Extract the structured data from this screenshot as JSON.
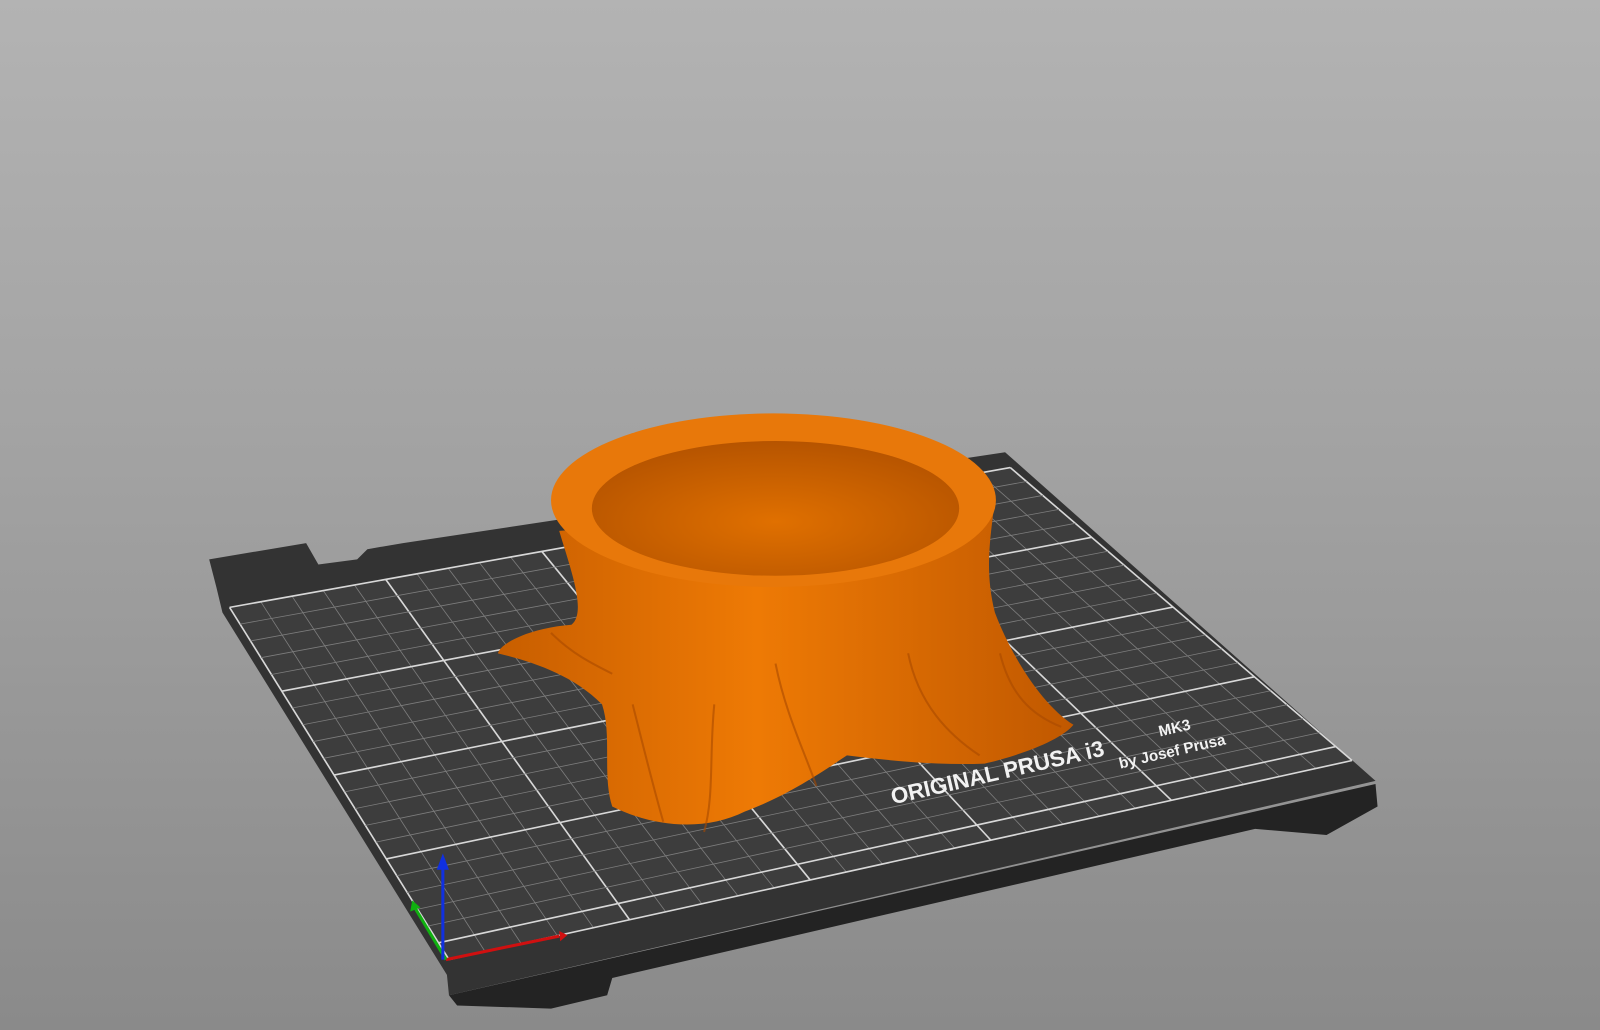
{
  "viewport": {
    "bed_logo_line1": "ORIGINAL PRUSA i3",
    "bed_logo_model": "MK3",
    "bed_logo_line2": "by Josef Prusa",
    "grid_divisions": [
      25,
      21
    ]
  },
  "colors": {
    "background_top": "#b3b3b3",
    "background_bottom": "#8a8a8a",
    "bed": "#2e2e2e",
    "grid": "#8c8c8c",
    "model": "#e67200",
    "axis_x": "#d01010",
    "axis_y": "#10b010",
    "axis_z": "#1030e0"
  }
}
